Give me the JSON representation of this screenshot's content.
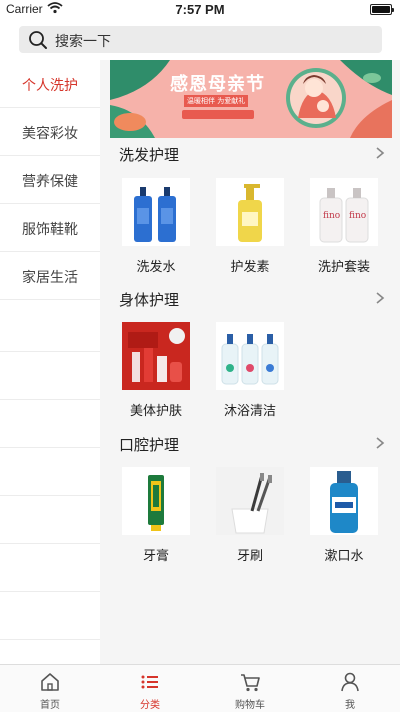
{
  "status_bar": {
    "carrier": "Carrier",
    "time": "7:57 PM"
  },
  "search": {
    "placeholder": "搜索一下"
  },
  "sidebar": {
    "items": [
      {
        "label": "个人洗护",
        "active": true
      },
      {
        "label": "美容彩妆",
        "active": false
      },
      {
        "label": "营养保健",
        "active": false
      },
      {
        "label": "服饰鞋靴",
        "active": false
      },
      {
        "label": "家居生活",
        "active": false
      }
    ]
  },
  "banner": {
    "title": "感恩母亲节",
    "subtitle": "温暖相伴 为爱献礼"
  },
  "sections": [
    {
      "title": "洗发护理",
      "products": [
        {
          "name": "洗发水",
          "icon": "shampoo-bottles"
        },
        {
          "name": "护发素",
          "icon": "conditioner-bottle"
        },
        {
          "name": "洗护套装",
          "icon": "care-set"
        }
      ]
    },
    {
      "title": "身体护理",
      "products": [
        {
          "name": "美体护肤",
          "icon": "skincare-set"
        },
        {
          "name": "沐浴清洁",
          "icon": "bodywash-bottles"
        }
      ]
    },
    {
      "title": "口腔护理",
      "products": [
        {
          "name": "牙膏",
          "icon": "toothpaste"
        },
        {
          "name": "牙刷",
          "icon": "toothbrush"
        },
        {
          "name": "漱口水",
          "icon": "mouthwash"
        }
      ]
    }
  ],
  "tabbar": {
    "items": [
      {
        "label": "首页",
        "icon": "home-icon"
      },
      {
        "label": "分类",
        "icon": "list-icon",
        "active": true
      },
      {
        "label": "购物车",
        "icon": "cart-icon"
      },
      {
        "label": "我",
        "icon": "user-icon"
      }
    ]
  },
  "colors": {
    "accent": "#d6352b",
    "content_bg": "#f5f5f5",
    "search_bg": "#ebebeb"
  }
}
